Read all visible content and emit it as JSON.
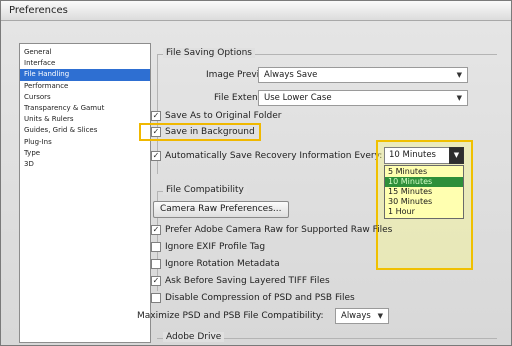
{
  "window": {
    "title": "Preferences"
  },
  "sidebar": {
    "items": [
      {
        "label": "General",
        "selected": false
      },
      {
        "label": "Interface",
        "selected": false
      },
      {
        "label": "File Handling",
        "selected": true
      },
      {
        "label": "Performance",
        "selected": false
      },
      {
        "label": "Cursors",
        "selected": false
      },
      {
        "label": "Transparency & Gamut",
        "selected": false
      },
      {
        "label": "Units & Rulers",
        "selected": false
      },
      {
        "label": "Guides, Grid & Slices",
        "selected": false
      },
      {
        "label": "Plug-Ins",
        "selected": false
      },
      {
        "label": "Type",
        "selected": false
      },
      {
        "label": "3D",
        "selected": false
      }
    ]
  },
  "file_saving": {
    "title": "File Saving Options",
    "image_previews_label": "Image Previews:",
    "image_previews_value": "Always Save",
    "file_extension_label": "File Extension:",
    "file_extension_value": "Use Lower Case",
    "save_as_original_folder": {
      "label": "Save As to Original Folder",
      "checked": true
    },
    "save_in_background": {
      "label": "Save in Background",
      "checked": true
    },
    "auto_save": {
      "label": "Automatically Save Recovery Information Every:",
      "checked": true
    },
    "interval_value": "10 Minutes",
    "interval_options": [
      "5 Minutes",
      "10 Minutes",
      "15 Minutes",
      "30 Minutes",
      "1 Hour"
    ],
    "interval_selected": "10 Minutes"
  },
  "compatibility": {
    "title": "File Compatibility",
    "camera_raw_button": "Camera Raw Preferences...",
    "prefer_camera_raw": {
      "label": "Prefer Adobe Camera Raw for Supported Raw Files",
      "checked": true
    },
    "ignore_exif": {
      "label": "Ignore EXIF Profile Tag",
      "checked": false
    },
    "ignore_rotation": {
      "label": "Ignore Rotation Metadata",
      "checked": false
    },
    "ask_tiff": {
      "label": "Ask Before Saving Layered TIFF Files",
      "checked": true
    },
    "disable_compression": {
      "label": "Disable Compression of PSD and PSB Files",
      "checked": false
    },
    "maximize_label": "Maximize PSD and PSB File Compatibility:",
    "maximize_value": "Always"
  },
  "adobe_drive": {
    "title": "Adobe Drive"
  },
  "colors": {
    "highlight": "#f0b800",
    "selection": "#2e6fd2",
    "dropdown_bg": "#ffffb0"
  }
}
